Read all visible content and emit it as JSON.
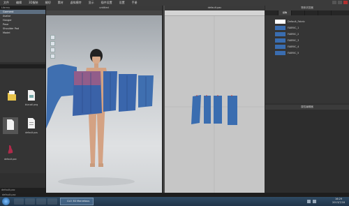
{
  "menu": [
    "文件",
    "编辑",
    "3D服装",
    "缝纫",
    "素材",
    "虚拟模特",
    "显示",
    "插件设置",
    "设置",
    "手册"
  ],
  "left_panel": {
    "tree_items": [
      "Garment",
      "Avatar",
      "Hanger",
      "Pose",
      "Shoulder Pad",
      "Model"
    ],
    "selected_index": 0,
    "files": [
      {
        "name": "",
        "icon": "folder-icon"
      },
      {
        "name": "blur.sdl.png",
        "icon": "image-file-icon"
      },
      {
        "name": "",
        "icon": "document-icon"
      },
      {
        "name": "default.pos",
        "icon": "document-icon"
      },
      {
        "name": "default.pac",
        "icon": "garment-icon"
      }
    ],
    "footer": "default.pac"
  },
  "view3d": {
    "title": "untitled"
  },
  "view2d": {
    "title": "default.pac"
  },
  "right_panel": {
    "title": "物体浏览器",
    "tabs": [
      "",
      "织物",
      "",
      "",
      ""
    ],
    "active_tab": 1,
    "items": [
      {
        "label": "Default_Fabric",
        "color": "#ffffff"
      },
      {
        "label": "FABRIC_1",
        "color": "#3a6db0"
      },
      {
        "label": "FABRIC_2",
        "color": "#3a6db0"
      },
      {
        "label": "FABRIC_3",
        "color": "#3a6db0"
      },
      {
        "label": "FABRIC_4",
        "color": "#3a6db0"
      },
      {
        "label": "FABRIC_5",
        "color": "#3a6db0"
      }
    ],
    "properties_title": "属性编辑器"
  },
  "status": "default.pac",
  "taskbar": {
    "app_label": "CLO 3D Marvelous",
    "clock_time": "16:29",
    "clock_date": "2013/7/16"
  },
  "colors": {
    "fabric_blue": "#3a6db0",
    "selection": "#5d6e80"
  }
}
